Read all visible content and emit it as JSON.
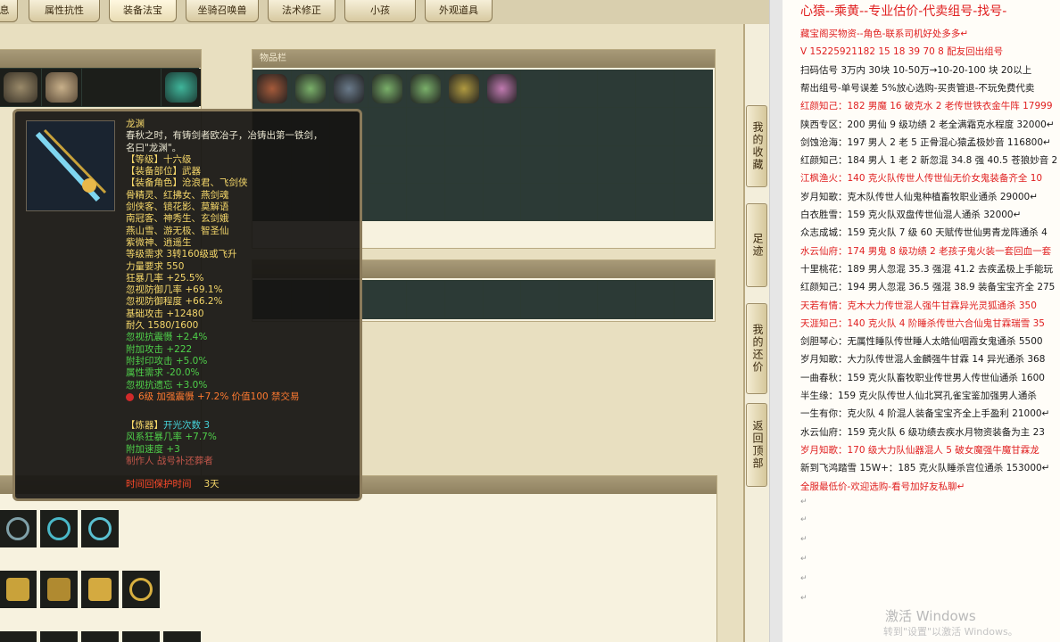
{
  "game": {
    "tabs": [
      "息",
      "属性抗性",
      "装备法宝",
      "坐骑召唤兽",
      "法术修正",
      "小孩",
      "外观道具"
    ],
    "inventory_title": "物品栏",
    "side_buttons": [
      "我的收藏",
      "足迹",
      "我的还价",
      "返回顶部"
    ],
    "tooltip": {
      "name": "龙渊",
      "desc_1": "春秋之时，有铸剑者欧冶子，冶铸出第一铁剑，",
      "desc_2": "名曰\"龙渊\"。",
      "level": "【等级】十六级",
      "slot": "【装备部位】武器",
      "roles_1": "【装备角色】沧浪君、飞剑侠",
      "roles_2": "骨精灵、红拂女、燕剑魂",
      "roles_3": "剑侠客、镜花影、莫解语",
      "roles_4": "南冠客、神秀生、玄剑娥",
      "roles_5": "燕山雪、游无极、智圣仙",
      "roles_6": "紫微神、逍遥生",
      "req_level": "等级需求 3转160级或飞升",
      "str_req": "力量要求 550",
      "stat_1": "狂暴几率 +25.5%",
      "stat_2": "忽视防御几率 +69.1%",
      "stat_3": "忽视防御程度 +66.2%",
      "stat_4": "基础攻击 +12480",
      "durability": "耐久 1580/1600",
      "stat_5": "忽视抗震慑 +2.4%",
      "stat_6": "附加攻击 +222",
      "stat_7": "附封印攻击 +5.0%",
      "stat_8": "属性需求 -20.0%",
      "stat_9": "忽视抗遗忘 +3.0%",
      "gem": "6级 加强震慑 +7.2% 价值100 禁交易",
      "refine_title": "【炼器】",
      "refine_count": "开光次数 3",
      "refine_1": "风系狂暴几率 +7.7%",
      "refine_2": "附加速度 +3",
      "maker": "制作人 战号补还葬者",
      "time_label": "时间回保护时间",
      "time_value": "3天"
    }
  },
  "doc": {
    "title": "心猿--乘黄--专业估价-代卖组号-找号-",
    "lines": [
      {
        "text": "藏宝阁买物资--角色-联系司机好处多多↵",
        "red": true
      },
      {
        "text": "V 15225921182  15 18 39 70 8 配友回出组号",
        "red": true
      },
      {
        "text": "扫码估号 3万内 30块  10-50万→10-20-100 块  20以上",
        "red": false
      },
      {
        "text": "帮出组号-单号误差 5%放心选购-买贵管退-不玩免费代卖",
        "red": false
      },
      {
        "text": "红颜知己：182 男魔 16 破克水 2 老传世铁衣金牛阵 17999",
        "red": true
      },
      {
        "text": "陕西专区：200 男仙 9 级功绩 2 老全满霜克水程度 32000↵",
        "red": false
      },
      {
        "text": "剑蚀沧海：197 男人 2 老 5 正骨混心猿孟极妙音 116800↵",
        "red": false
      },
      {
        "text": "红颜知己：184 男人 1 老 2 新忽混 34.8 强 40.5 苍狼妙音 2",
        "red": false
      },
      {
        "text": "江枫渔火：140 克火队传世人传世仙无价女鬼装备齐全 10",
        "red": true
      },
      {
        "text": "岁月知歌：克木队传世人仙鬼种植畜牧职业通杀 29000↵",
        "red": false
      },
      {
        "text": "白衣胜雪：159 克火队双盘传世仙混人通杀 32000↵",
        "red": false
      },
      {
        "text": "众志成城：159 克火队 7 级 60 天赋传世仙男青龙阵通杀 4",
        "red": false
      },
      {
        "text": "水云仙府：174 男鬼 8 级功绩 2 老孩子鬼火装一套回血一套",
        "red": true
      },
      {
        "text": "十里桃花：189 男人忽混 35.3 强混 41.2 去疾孟极上手能玩",
        "red": false
      },
      {
        "text": "红颜知己：194 男人忽混 36.5 强混 38.9 装备宝宝齐全 275",
        "red": false
      },
      {
        "text": "天若有情：克木大力传世混人强牛甘霖异光灵狐通杀 350",
        "red": true
      },
      {
        "text": "天涯知己：140 克火队 4 阶睡杀传世六合仙鬼甘霖瑞雪 35",
        "red": true
      },
      {
        "text": "剑胆琴心：无属性睡队传世睡人太皓仙咽霞女鬼通杀 5500",
        "red": false
      },
      {
        "text": "岁月知歌：大力队传世混人金麟强牛甘霖 14 异光通杀 368",
        "red": false
      },
      {
        "text": "一曲春秋：159 克火队畜牧职业传世男人传世仙通杀 1600",
        "red": false
      },
      {
        "text": "半生缘：159 克火队传世人仙北冥孔雀宝鉴加强男人通杀",
        "red": false
      },
      {
        "text": "一生有你：克火队 4 阶混人装备宝宝齐全上手盈利 21000↵",
        "red": false
      },
      {
        "text": "水云仙府：159 克火队 6 级功绩去疾水月物资装备为主 23",
        "red": false
      },
      {
        "text": "岁月知歌：170 级大力队仙器混人 5 破女魔强牛魔甘霖龙",
        "red": true
      },
      {
        "text": "新到飞鸿踏雪 15W+：185 克火队睡杀宫位通杀 153000↵",
        "red": false
      },
      {
        "text": "全服最低价-欢迎选购-看号加好友私聊↵",
        "red": true
      }
    ],
    "watermark_1": "激活 Windows",
    "watermark_2": "转到\"设置\"以激活 Windows。"
  },
  "colors": {
    "accent_red": "#e02020",
    "tooltip_yellow": "#f5d76a",
    "tooltip_green": "#4fd04a",
    "tooltip_cyan": "#45d2d8"
  }
}
